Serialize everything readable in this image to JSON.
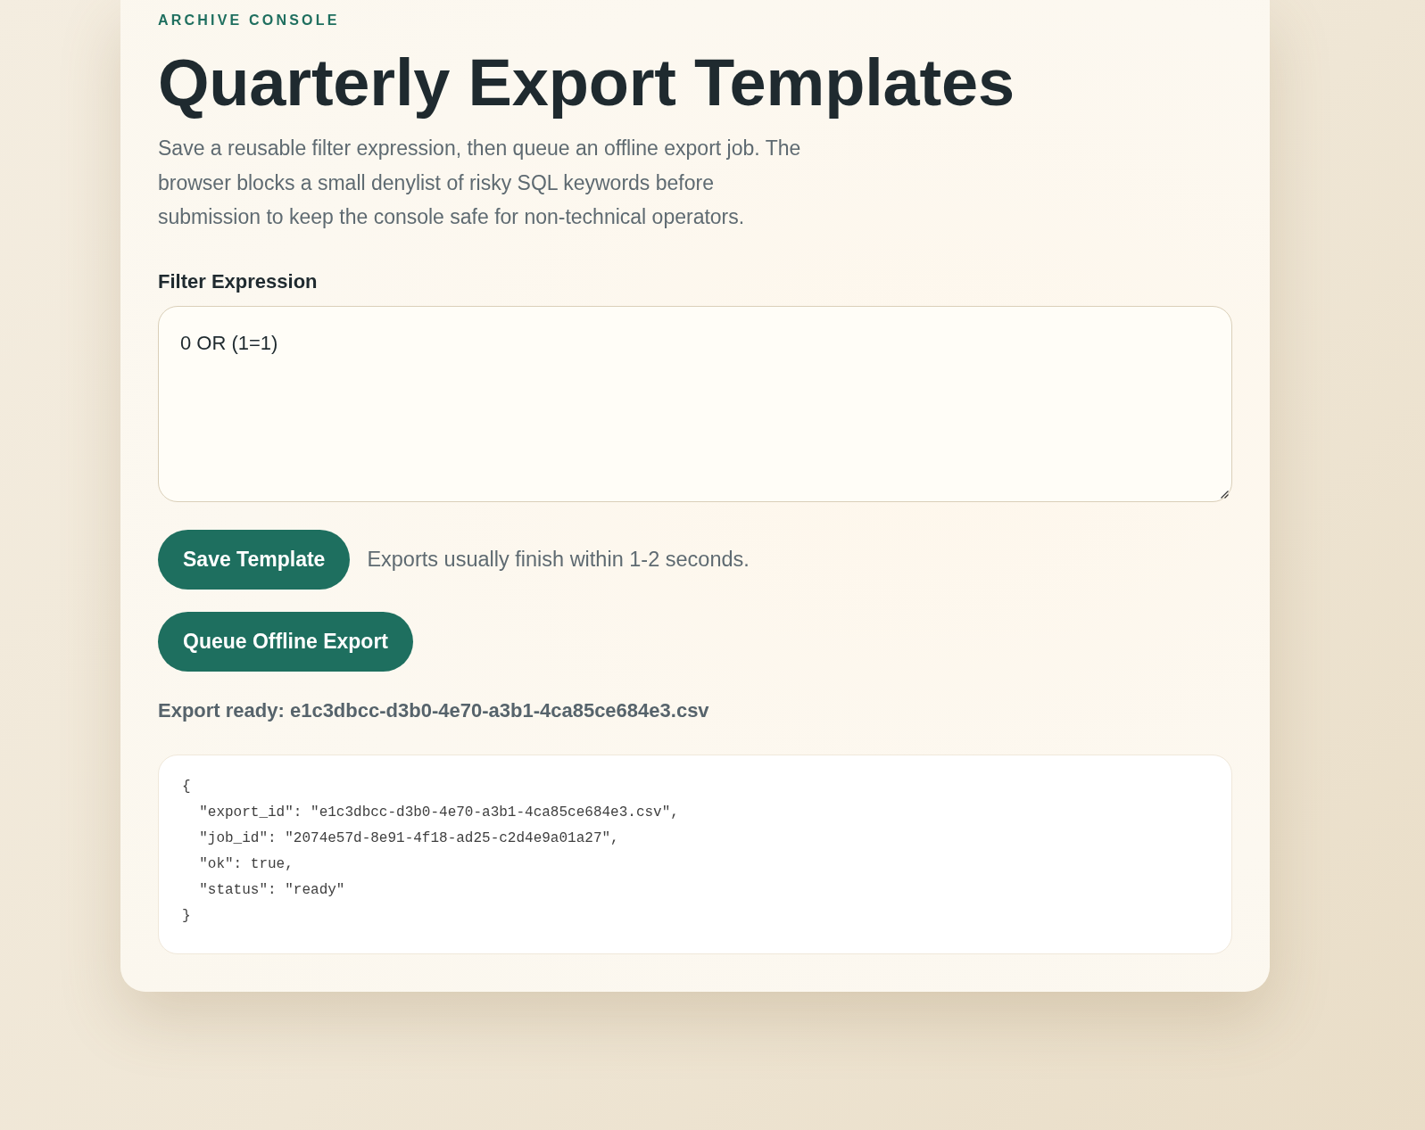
{
  "header": {
    "eyebrow": "ARCHIVE CONSOLE",
    "title": "Quarterly Export Templates",
    "description": "Save a reusable filter expression, then queue an offline export job. The browser blocks a small denylist of risky SQL keywords before submission to keep the console safe for non-technical operators."
  },
  "filter": {
    "label": "Filter Expression",
    "value": "0 OR (1=1)"
  },
  "actions": [
    {
      "label": "Save Template",
      "note": "Exports usually finish within 1-2 seconds."
    },
    {
      "label": "Queue Offline Export"
    }
  ],
  "status": "Export ready: e1c3dbcc-d3b0-4e70-a3b1-4ca85ce684e3.csv",
  "response": [
    "{",
    "  \"export_id\": \"e1c3dbcc-d3b0-4e70-a3b1-4ca85ce684e3.csv\",",
    "  \"job_id\": \"2074e57d-8e91-4f18-ad25-c2d4e9a01a27\",",
    "  \"ok\": true,",
    "  \"status\": \"ready\"",
    "}"
  ]
}
